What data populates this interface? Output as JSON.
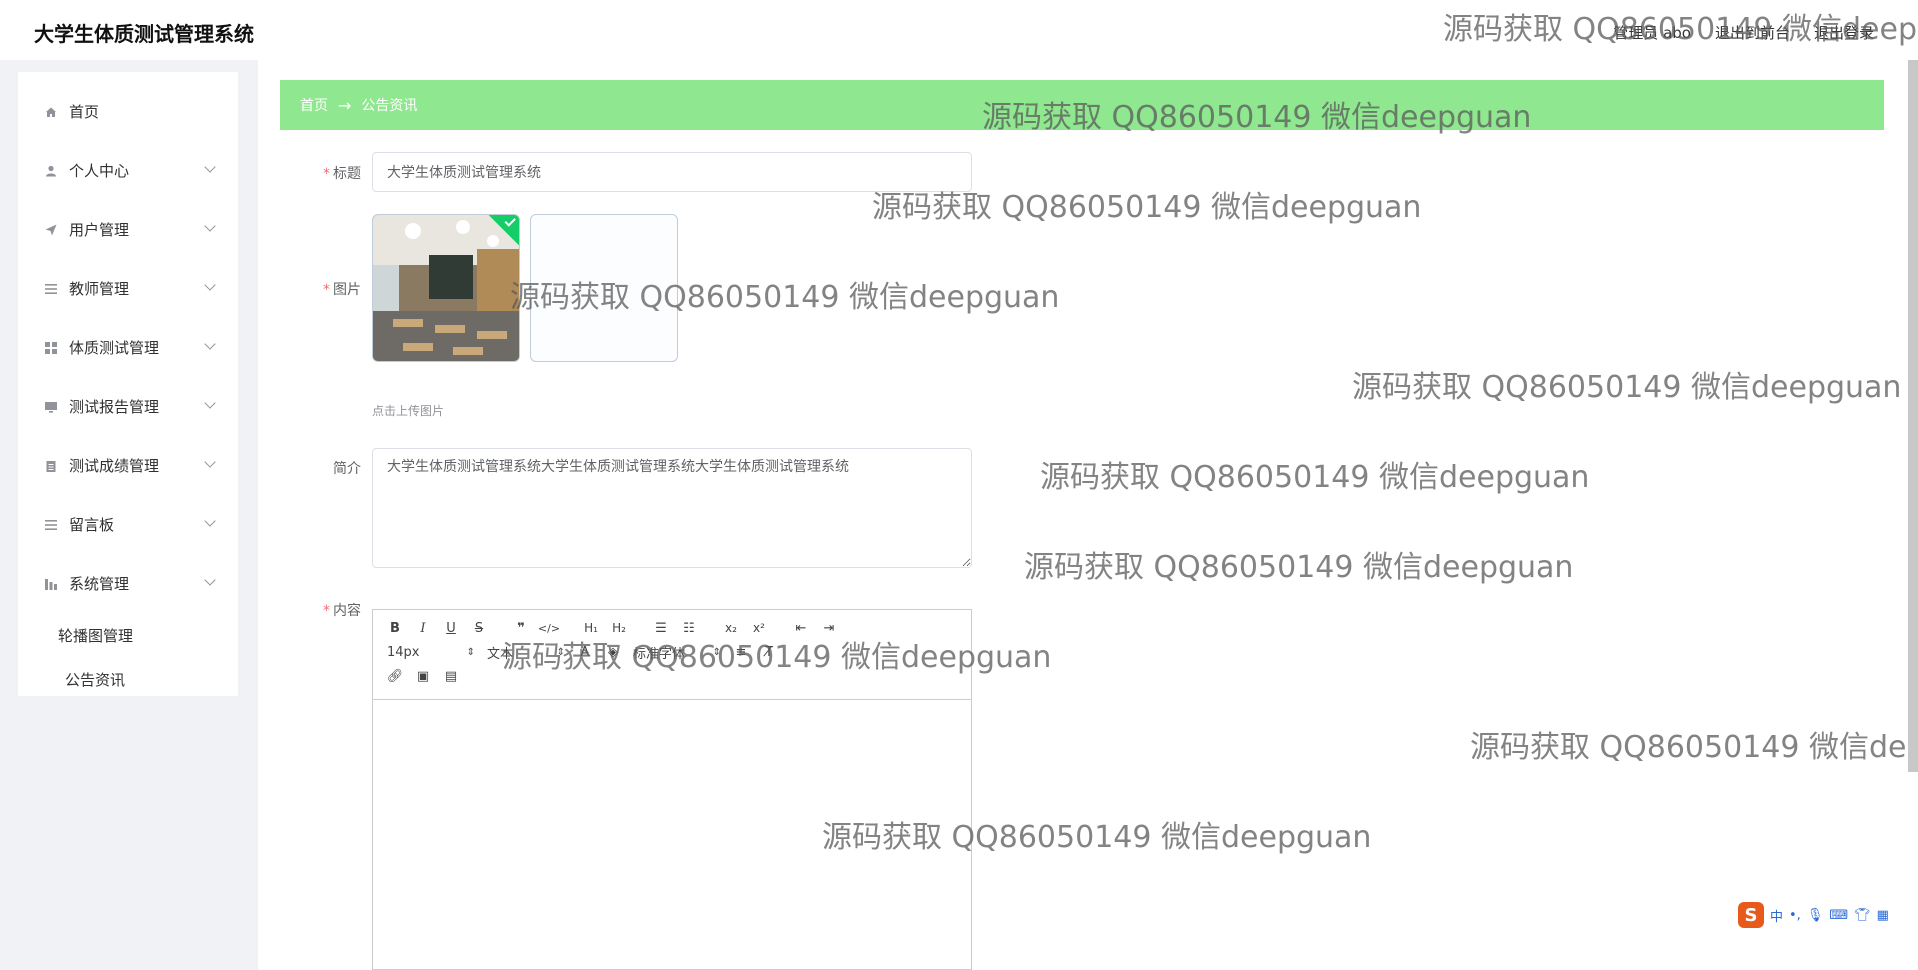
{
  "app": {
    "title": "大学生体质测试管理系统"
  },
  "topbar": {
    "user": "管理员 abo",
    "back_front": "退出到前台",
    "logout": "退出登录"
  },
  "sidebar": {
    "items": [
      {
        "label": "首页",
        "icon": "home-icon"
      },
      {
        "label": "个人中心",
        "icon": "user-icon"
      },
      {
        "label": "用户管理",
        "icon": "send-icon"
      },
      {
        "label": "教师管理",
        "icon": "list-icon"
      },
      {
        "label": "体质测试管理",
        "icon": "grid-icon"
      },
      {
        "label": "测试报告管理",
        "icon": "monitor-icon"
      },
      {
        "label": "测试成绩管理",
        "icon": "clipboard-icon"
      },
      {
        "label": "留言板",
        "icon": "list-icon"
      },
      {
        "label": "系统管理",
        "icon": "chart-icon"
      }
    ],
    "subitems": [
      {
        "label": "轮播图管理"
      },
      {
        "label": "公告资讯"
      }
    ]
  },
  "breadcrumb": {
    "home": "首页",
    "current": "公告资讯"
  },
  "form": {
    "title_label": "标题",
    "title_value": "大学生体质测试管理系统",
    "pic_label": "图片",
    "upload_tip": "点击上传图片",
    "intro_label": "简介",
    "intro_value": "大学生体质测试管理系统大学生体质测试管理系统大学生体质测试管理系统",
    "content_label": "内容"
  },
  "editor": {
    "font_size": "14px",
    "text_style": "文本",
    "font_family": "标准字体"
  },
  "watermark": {
    "text": "源码获取 QQ86050149 微信deepguan"
  },
  "ime": {
    "logo": "S",
    "lang": "中"
  }
}
